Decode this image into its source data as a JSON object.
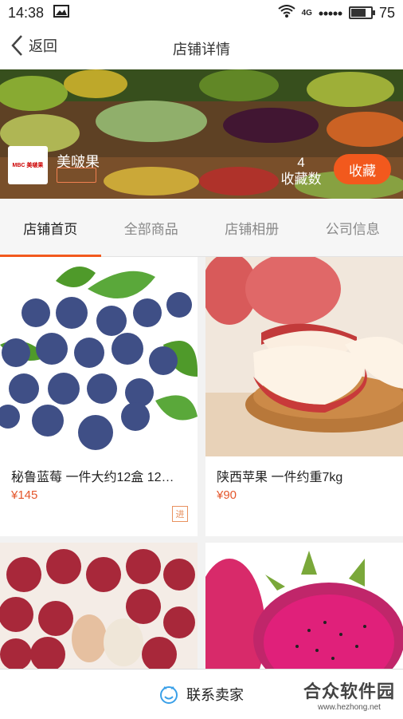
{
  "status": {
    "time": "14:38",
    "network": "4G",
    "battery": "75",
    "battery_level": 0.75
  },
  "header": {
    "back_label": "返回",
    "title": "店铺详情"
  },
  "shop": {
    "logo_text": "MBC 美啵果",
    "name": "美啵果",
    "favorites_count": "4",
    "favorites_label": "收藏数",
    "favorite_button": "收藏"
  },
  "tabs": [
    {
      "label": "店铺首页",
      "active": true
    },
    {
      "label": "全部商品",
      "active": false
    },
    {
      "label": "店铺相册",
      "active": false
    },
    {
      "label": "公司信息",
      "active": false
    }
  ],
  "products": [
    {
      "name": "秘鲁蓝莓  一件大约12盒  12…",
      "price": "¥145",
      "tag": "进",
      "image": "blueberries"
    },
    {
      "name": "陕西苹果  一件约重7kg",
      "price": "¥90",
      "tag": "",
      "image": "apples"
    },
    {
      "name": "",
      "price": "",
      "tag": "",
      "image": "grapes"
    },
    {
      "name": "",
      "price": "",
      "tag": "",
      "image": "dragon-fruit"
    }
  ],
  "bottom": {
    "contact_label": "联系卖家",
    "watermark_title": "合众软件园",
    "watermark_url": "www.hezhong.net"
  },
  "colors": {
    "accent": "#f2591d",
    "price": "#e4562b"
  }
}
